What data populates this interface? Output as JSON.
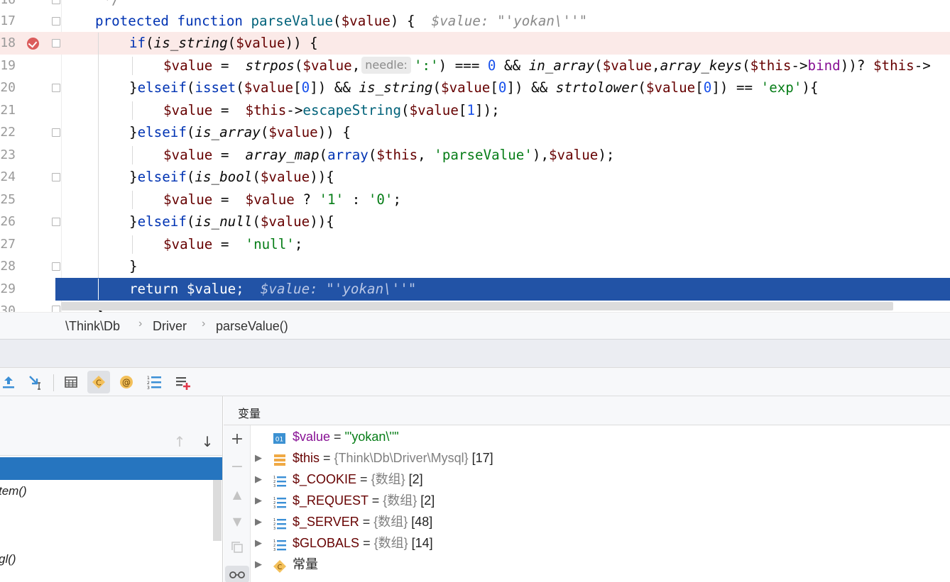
{
  "editor": {
    "lines": [
      {
        "num": "16"
      },
      {
        "num": "17"
      },
      {
        "num": "18"
      },
      {
        "num": "19"
      },
      {
        "num": "20"
      },
      {
        "num": "21"
      },
      {
        "num": "22"
      },
      {
        "num": "23"
      },
      {
        "num": "24"
      },
      {
        "num": "25"
      },
      {
        "num": "26"
      },
      {
        "num": "27"
      },
      {
        "num": "28"
      },
      {
        "num": "29"
      },
      {
        "num": "30"
      }
    ],
    "inline_hint_17": "$value: \"'yokan\\''\"",
    "param_hint_needle": "needle:",
    "inline_hint_29": "$value: \"'yokan\\''\""
  },
  "breadcrumb": {
    "items": [
      "\\Think\\Db",
      "Driver",
      "parseValue()"
    ]
  },
  "toolbar": {
    "icons": [
      "step-out-icon",
      "run-to-cursor-icon",
      "evaluate-icon",
      "constants-icon",
      "annotation-icon",
      "list-icon",
      "add-watch-icon"
    ]
  },
  "frames": {
    "items": [
      "",
      "tem()",
      ")",
      "",
      "gl()"
    ]
  },
  "variables": {
    "title": "变量",
    "rows": [
      {
        "name": "$value",
        "eq": " = ",
        "type": "",
        "value": "\"'yokan\\''\"",
        "count": ""
      },
      {
        "name": "$this",
        "eq": " = ",
        "type": "{Think\\Db\\Driver\\Mysql}",
        "value": "",
        "count": " [17]"
      },
      {
        "name": "$_COOKIE",
        "eq": " = ",
        "type": "{数组}",
        "value": "",
        "count": " [2]"
      },
      {
        "name": "$_REQUEST",
        "eq": " = ",
        "type": "{数组}",
        "value": "",
        "count": " [2]"
      },
      {
        "name": "$_SERVER",
        "eq": " = ",
        "type": "{数组}",
        "value": "",
        "count": " [48]"
      },
      {
        "name": "$GLOBALS",
        "eq": " = ",
        "type": "{数组}",
        "value": "",
        "count": " [14]"
      },
      {
        "name": "常量",
        "eq": "",
        "type": "",
        "value": "",
        "count": ""
      }
    ]
  },
  "colors": {
    "execution_line": "#2253a6",
    "breakpoint_line": "#fbeae8",
    "selected_frame": "#2675bf"
  }
}
